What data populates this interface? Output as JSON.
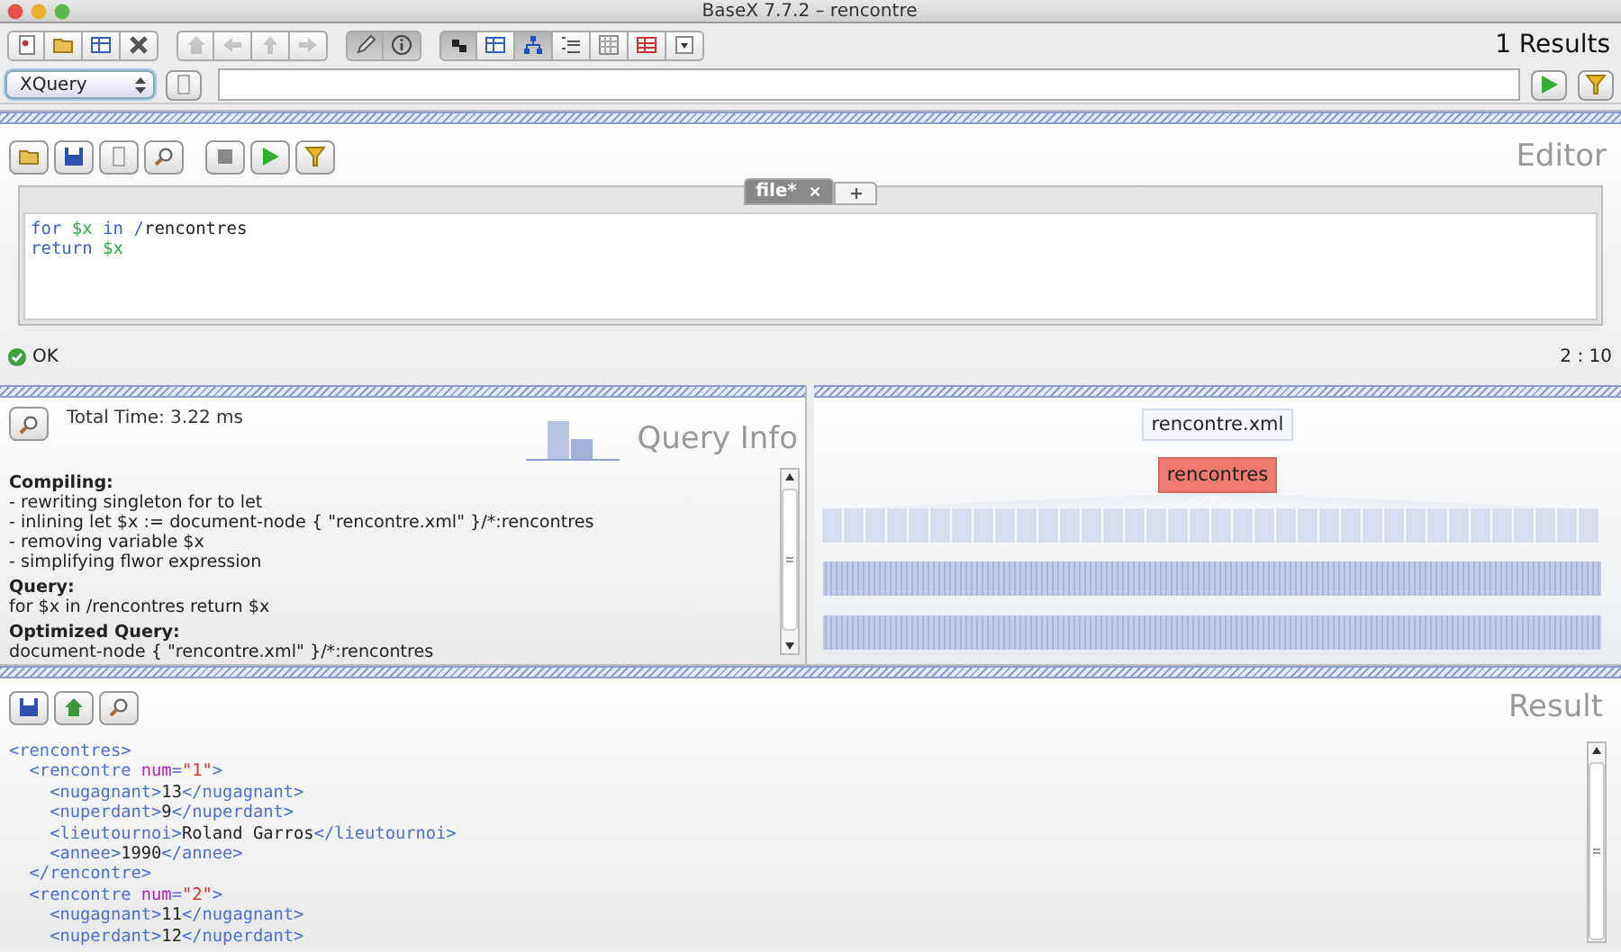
{
  "window": {
    "title": "BaseX 7.7.2 – rencontre"
  },
  "toolbar": {
    "groups": [
      [
        {
          "pressed": false,
          "disabled": false
        },
        {
          "pressed": false,
          "disabled": false
        },
        {
          "pressed": false,
          "disabled": false
        },
        {
          "pressed": false,
          "disabled": false
        }
      ],
      [
        {
          "pressed": false,
          "disabled": true
        },
        {
          "pressed": false,
          "disabled": true
        },
        {
          "pressed": false,
          "disabled": true
        },
        {
          "pressed": false,
          "disabled": true
        }
      ],
      [
        {
          "pressed": true,
          "disabled": false
        },
        {
          "pressed": true,
          "disabled": false
        }
      ],
      [
        {
          "pressed": true,
          "disabled": false
        },
        {
          "pressed": false,
          "disabled": false
        },
        {
          "pressed": true,
          "disabled": false
        },
        {
          "pressed": false,
          "disabled": false
        },
        {
          "pressed": false,
          "disabled": false
        },
        {
          "pressed": false,
          "disabled": false
        },
        {
          "pressed": false,
          "disabled": false
        }
      ]
    ],
    "result_count": "1 Results"
  },
  "query_bar": {
    "mode": "XQuery"
  },
  "editor": {
    "title": "Editor",
    "tabs": [
      {
        "label": "file*",
        "selected": true
      }
    ],
    "code": [
      [
        {
          "text": "for ",
          "kind": "keyword"
        },
        {
          "text": "$x ",
          "kind": "variable"
        },
        {
          "text": "in ",
          "kind": "keyword"
        },
        {
          "text": "/",
          "kind": "keyword"
        },
        {
          "text": "rencontres",
          "kind": "text"
        }
      ],
      [
        {
          "text": "return ",
          "kind": "keyword"
        },
        {
          "text": "$x",
          "kind": "variable"
        }
      ]
    ],
    "status": "OK",
    "cursor": "2 : 10"
  },
  "query_info": {
    "title": "Query Info",
    "total_time": "Total Time: 3.22 ms",
    "sections": [
      {
        "heading": "Compiling:",
        "lines": [
          "- rewriting singleton for to let",
          "- inlining let $x := document-node { \"rencontre.xml\" }/*:rencontres",
          "- removing variable $x",
          "- simplifying flwor expression"
        ]
      },
      {
        "heading": "Query:",
        "lines": [
          "for $x in /rencontres return $x"
        ]
      },
      {
        "heading": "Optimized Query:",
        "lines": [
          "document-node { \"rencontre.xml\" }/*:rencontres"
        ]
      }
    ]
  },
  "tree_view": {
    "root": "rencontre.xml",
    "node": "rencontres"
  },
  "result": {
    "title": "Result",
    "lines": [
      [
        {
          "text": "<rencontres>",
          "kind": "tag"
        }
      ],
      [
        {
          "text": "  <rencontre ",
          "kind": "tag"
        },
        {
          "text": "num",
          "kind": "attribute"
        },
        {
          "text": "=",
          "kind": "tag"
        },
        {
          "text": "\"1\"",
          "kind": "value"
        },
        {
          "text": ">",
          "kind": "tag"
        }
      ],
      [
        {
          "text": "    <nugagnant>",
          "kind": "tag"
        },
        {
          "text": "13",
          "kind": "text"
        },
        {
          "text": "</nugagnant>",
          "kind": "tag"
        }
      ],
      [
        {
          "text": "    <nuperdant>",
          "kind": "tag"
        },
        {
          "text": "9",
          "kind": "text"
        },
        {
          "text": "</nuperdant>",
          "kind": "tag"
        }
      ],
      [
        {
          "text": "    <lieutournoi>",
          "kind": "tag"
        },
        {
          "text": "Roland Garros",
          "kind": "text"
        },
        {
          "text": "</lieutournoi>",
          "kind": "tag"
        }
      ],
      [
        {
          "text": "    <annee>",
          "kind": "tag"
        },
        {
          "text": "1990",
          "kind": "text"
        },
        {
          "text": "</annee>",
          "kind": "tag"
        }
      ],
      [
        {
          "text": "  </rencontre>",
          "kind": "tag"
        }
      ],
      [
        {
          "text": "  <rencontre ",
          "kind": "tag"
        },
        {
          "text": "num",
          "kind": "attribute"
        },
        {
          "text": "=",
          "kind": "tag"
        },
        {
          "text": "\"2\"",
          "kind": "value"
        },
        {
          "text": ">",
          "kind": "tag"
        }
      ],
      [
        {
          "text": "    <nugagnant>",
          "kind": "tag"
        },
        {
          "text": "11",
          "kind": "text"
        },
        {
          "text": "</nugagnant>",
          "kind": "tag"
        }
      ],
      [
        {
          "text": "    <nuperdant>",
          "kind": "tag"
        },
        {
          "text": "12",
          "kind": "text"
        },
        {
          "text": "</nuperdant>",
          "kind": "tag"
        }
      ]
    ]
  }
}
